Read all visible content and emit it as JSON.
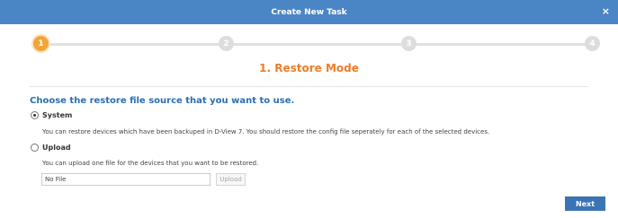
{
  "window": {
    "title": "Create New Task",
    "close_label": "×"
  },
  "stepper": {
    "steps": [
      {
        "number": "1",
        "state": "active"
      },
      {
        "number": "2",
        "state": "inactive"
      },
      {
        "number": "3",
        "state": "inactive"
      },
      {
        "number": "4",
        "state": "inactive"
      }
    ],
    "current_title": "1. Restore Mode"
  },
  "form": {
    "heading": "Choose the restore file source that you want to use.",
    "options": [
      {
        "label": "System",
        "checked": true,
        "description": "You can restore devices which have been backuped in D-View 7. You should restore the config file seperately for each of the selected devices."
      },
      {
        "label": "Upload",
        "checked": false,
        "description": "You can upload one file for the devices that you want to be restored."
      }
    ],
    "file_value": "No File",
    "upload_label": "Upload"
  },
  "footer": {
    "next_label": "Next"
  },
  "colors": {
    "titlebar": "#4a86c5",
    "active_step": "#f0a53a",
    "step_title": "#ef7d26",
    "heading": "#2a6fb3",
    "next_button": "#3b74b4"
  }
}
